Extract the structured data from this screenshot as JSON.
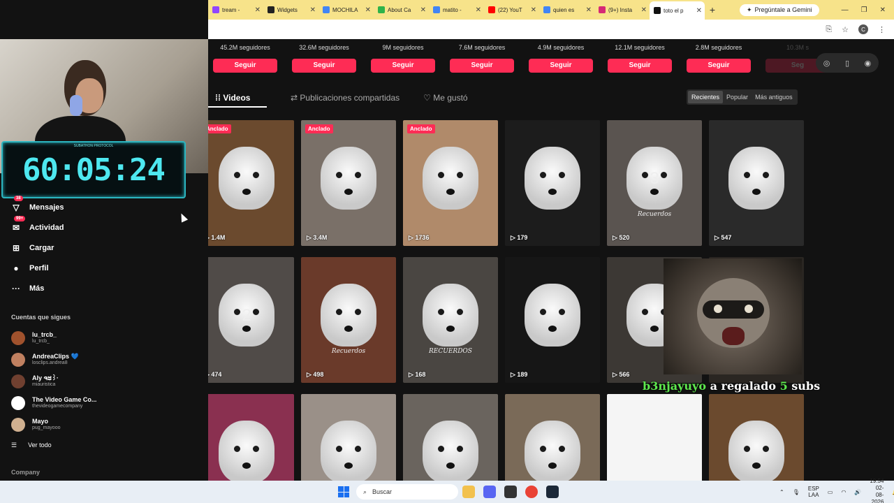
{
  "browser": {
    "tabs": [
      {
        "label": "tream -",
        "color": "#9146ff"
      },
      {
        "label": "Widgets",
        "color": "#222"
      },
      {
        "label": "MOCHILA",
        "color": "#4285f4"
      },
      {
        "label": "About Ca",
        "color": "#2fb34a"
      },
      {
        "label": "matito -",
        "color": "#4285f4"
      },
      {
        "label": "(22) YouT",
        "color": "#ff0000"
      },
      {
        "label": "quien es",
        "color": "#4285f4"
      },
      {
        "label": "(9+) Insta",
        "color": "#d62976"
      },
      {
        "label": "toto el p",
        "color": "#111"
      }
    ],
    "new_tab": "+",
    "gemini": "Pregúntale a Gemini",
    "profile_initial": "C"
  },
  "suggested": [
    {
      "followers": "45.2M seguidores",
      "button": "Seguir"
    },
    {
      "followers": "32.6M seguidores",
      "button": "Seguir"
    },
    {
      "followers": "9M seguidores",
      "button": "Seguir"
    },
    {
      "followers": "7.6M seguidores",
      "button": "Seguir"
    },
    {
      "followers": "4.9M seguidores",
      "button": "Seguir"
    },
    {
      "followers": "12.1M seguidores",
      "button": "Seguir"
    },
    {
      "followers": "2.8M seguidores",
      "button": "Seguir"
    },
    {
      "followers": "10.3M s",
      "button": "Seg"
    }
  ],
  "profile_tabs": {
    "videos": "Videos",
    "shared": "Publicaciones compartidas",
    "liked": "Me gustó"
  },
  "sort": {
    "recent": "Recientes",
    "popular": "Popular",
    "oldest": "Más antiguos"
  },
  "pinned_label": "Anclado",
  "videos": [
    {
      "views": "1.4M",
      "pinned": true,
      "bg": "#6b4a2e"
    },
    {
      "views": "3.4M",
      "pinned": true,
      "bg": "#7a7068"
    },
    {
      "views": "1736",
      "pinned": true,
      "bg": "#b08a6a"
    },
    {
      "views": "179",
      "pinned": false,
      "bg": "#1c1c1c"
    },
    {
      "views": "520",
      "pinned": false,
      "bg": "#5a5450",
      "caption": "Recuerdos",
      "num": "3"
    },
    {
      "views": "547",
      "pinned": false,
      "bg": "#2a2a2a"
    },
    {
      "views": "474",
      "pinned": false,
      "bg": "#504b48",
      "num": "2"
    },
    {
      "views": "498",
      "pinned": false,
      "bg": "#6a3a2a",
      "caption": "Recuerdos"
    },
    {
      "views": "168",
      "pinned": false,
      "bg": "#4a4642",
      "caption": "RECUERDOS"
    },
    {
      "views": "189",
      "pinned": false,
      "bg": "#161616"
    },
    {
      "views": "566",
      "pinned": false,
      "bg": "#3c3834"
    },
    {
      "views": "",
      "pinned": false,
      "bg": "#2a2622"
    },
    {
      "views": "",
      "pinned": false,
      "bg": "#8a3050"
    },
    {
      "views": "",
      "pinned": false,
      "bg": "#9a9088"
    },
    {
      "views": "",
      "pinned": false,
      "bg": "#6a645e"
    },
    {
      "views": "",
      "pinned": false,
      "bg": "#7a6a58"
    },
    {
      "views": "",
      "pinned": false,
      "bg": "#f5f5f5"
    },
    {
      "views": "",
      "pinned": false,
      "bg": "#6b4a2e"
    }
  ],
  "stream": {
    "timer": "60:05:24",
    "timer_caption": "SUBATHON PROTOCOL"
  },
  "alert": {
    "user": "b3njayuyo",
    "text": " a regalado ",
    "count": "5",
    "suffix": " subs"
  },
  "nav": [
    {
      "icon": "▽",
      "label": "Mensajes",
      "badge": "38"
    },
    {
      "icon": "✉",
      "label": "Actividad",
      "badge": "99+"
    },
    {
      "icon": "⊞",
      "label": "Cargar",
      "badge": ""
    },
    {
      "icon": "●",
      "label": "Perfil",
      "badge": ""
    },
    {
      "icon": "···",
      "label": "Más",
      "badge": ""
    }
  ],
  "following": {
    "title": "Cuentas que sigues",
    "accounts": [
      {
        "name": "lu_trcb_",
        "handle": "lu_trcb_",
        "color": "#a0522d"
      },
      {
        "name": "AndreaClips 💙",
        "handle": "losclips.andrea8",
        "color": "#c08060"
      },
      {
        "name": "Aly ຈະ꒱·",
        "handle": "miauristica",
        "color": "#704030"
      },
      {
        "name": "The Video Game Co...",
        "handle": "thevideogamecompany",
        "color": "#ffffff"
      },
      {
        "name": "Mayo",
        "handle": "pug_mayooo",
        "color": "#d0b090"
      }
    ],
    "see_all": "Ver todo"
  },
  "company": "Company",
  "taskbar": {
    "search": "Buscar",
    "lang1": "ESP",
    "lang2": "LAA",
    "time": "19:54",
    "date": "02-08-2026"
  }
}
